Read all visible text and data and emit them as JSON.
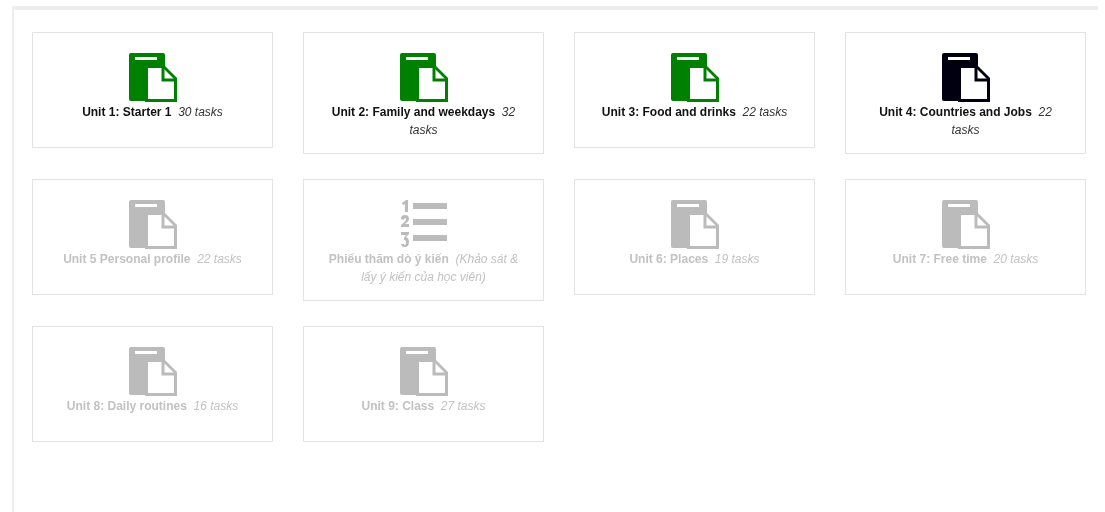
{
  "units": [
    {
      "kind": "document",
      "color": "#008000",
      "disabled": false,
      "title": "Unit 1: Starter 1",
      "count": "30 tasks"
    },
    {
      "kind": "document",
      "color": "#008000",
      "disabled": false,
      "title": "Unit 2: Family and weekdays",
      "count": "32 tasks"
    },
    {
      "kind": "document",
      "color": "#008000",
      "disabled": false,
      "title": "Unit 3: Food and drinks",
      "count": "22 tasks"
    },
    {
      "kind": "document",
      "color": "#000010",
      "disabled": false,
      "title": "Unit 4: Countries and Jobs",
      "count": "22 tasks"
    },
    {
      "kind": "document",
      "color": "#bbbbbb",
      "disabled": true,
      "title": "Unit 5 Personal profile",
      "count": "22 tasks"
    },
    {
      "kind": "list",
      "color": "#bbbbbb",
      "disabled": true,
      "title": "Phiếu thăm dò ý kiến",
      "count": "(Khảo sát & lấy ý kiến của học viên)"
    },
    {
      "kind": "document",
      "color": "#bbbbbb",
      "disabled": true,
      "title": "Unit 6: Places",
      "count": "19 tasks"
    },
    {
      "kind": "document",
      "color": "#bbbbbb",
      "disabled": true,
      "title": "Unit 7: Free time",
      "count": "20 tasks"
    },
    {
      "kind": "document",
      "color": "#bbbbbb",
      "disabled": true,
      "title": "Unit 8: Daily routines",
      "count": "16 tasks"
    },
    {
      "kind": "document",
      "color": "#bbbbbb",
      "disabled": true,
      "title": "Unit 9: Class",
      "count": "27 tasks"
    }
  ]
}
